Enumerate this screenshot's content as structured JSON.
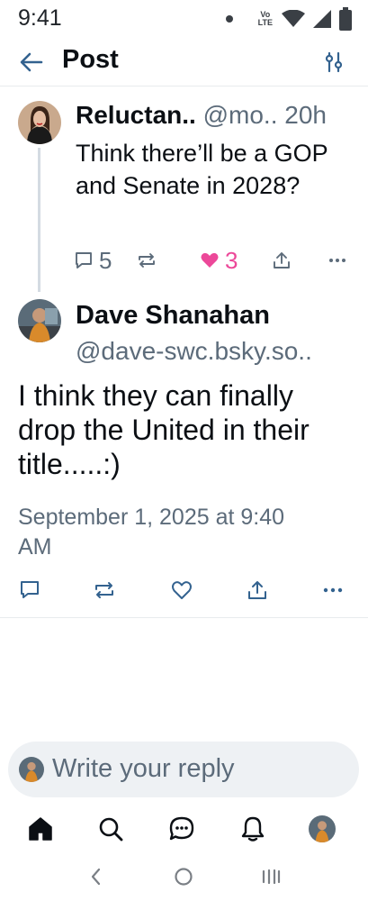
{
  "status_bar": {
    "time": "9:41",
    "volte_line1": "Vo",
    "volte_line2": "LTE",
    "icons": [
      "dot-icon",
      "volte-icon",
      "wifi-icon",
      "signal-icon",
      "battery-icon"
    ]
  },
  "header": {
    "title": "Post",
    "back_icon": "arrow-left-icon",
    "filter_icon": "sliders-icon"
  },
  "parent_post": {
    "display_name": "Reluctan..",
    "handle": "@mo..",
    "time_ago": "20h",
    "text": "Think there’ll be a GOP and Senate in 2028?",
    "reply_count": "5",
    "like_count": "3",
    "liked": true
  },
  "focused_post": {
    "display_name": "Dave Shanahan",
    "handle": "@dave-swc.bsky.so..",
    "text": "I think they can finally drop the United in their title.....:)",
    "date": "September 1, 2025 at 9:40 AM"
  },
  "reply": {
    "placeholder": "Write your reply"
  },
  "bottom_nav": {
    "items": [
      "home-icon",
      "search-icon",
      "chat-icon",
      "bell-icon",
      "profile-avatar"
    ]
  },
  "system_nav": {
    "items": [
      "back-chevron-icon",
      "home-circle-icon",
      "recents-icon"
    ]
  },
  "colors": {
    "text": "#0b0f14",
    "muted": "#5c6b7a",
    "accent": "#1083fe",
    "like": "#ec4899",
    "thread_line": "#d4dbe2",
    "reply_bg": "#eef1f4"
  }
}
